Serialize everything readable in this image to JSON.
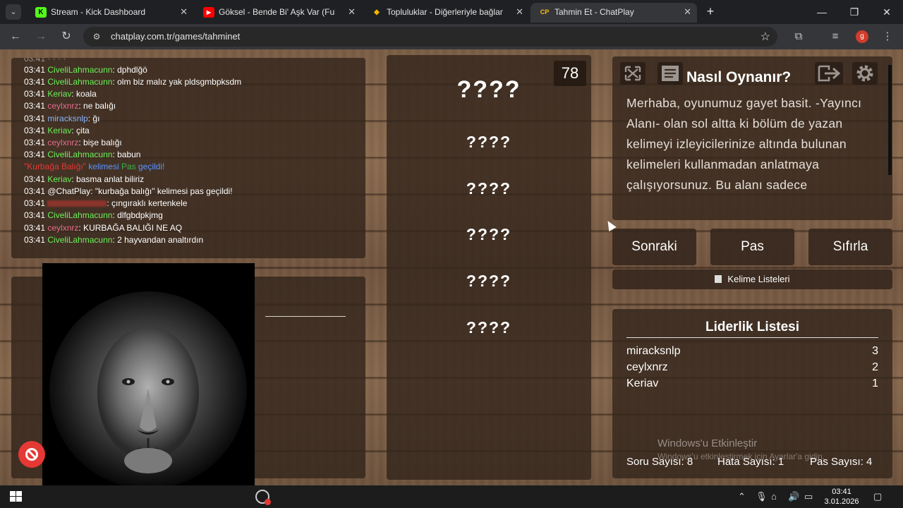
{
  "browser": {
    "tabs": [
      {
        "title": "Stream - Kick Dashboard",
        "favicon": "kick-icon",
        "color": "#53fc18",
        "glyph": "K"
      },
      {
        "title": "Göksel - Bende Bi' Aşk Var (Full",
        "favicon": "youtube-icon",
        "color": "#ff0000",
        "glyph": "▶"
      },
      {
        "title": "Topluluklar - Diğerleriyle bağlan",
        "favicon": "community-icon",
        "color": "#f4b400",
        "glyph": "◆"
      },
      {
        "title": "Tahmin Et - ChatPlay",
        "favicon": "chatplay-icon",
        "color": "#fbbc04",
        "glyph": "CP"
      }
    ],
    "url": "chatplay.com.tr/games/tahminet",
    "profile_initial": "g"
  },
  "chat": {
    "messages": [
      {
        "time": "03:41",
        "user": "CiveliLahmacunn",
        "user_color": "green",
        "text": ": dphdlğö"
      },
      {
        "time": "03:41",
        "user": "CiveliLahmacunn",
        "user_color": "green",
        "text": ": olm biz malız yak pldsgmbpksdm"
      },
      {
        "time": "03:41",
        "user": "Keriav",
        "user_color": "green",
        "text": ": koala"
      },
      {
        "time": "03:41",
        "user": "ceylxnrz",
        "user_color": "pink",
        "text": ": ne balığı"
      },
      {
        "time": "03:41",
        "user": "miracksnlp",
        "user_color": "blue",
        "text": ": ğı"
      },
      {
        "time": "03:41",
        "user": "Keriav",
        "user_color": "green",
        "text": ": çita"
      },
      {
        "time": "03:41",
        "user": "ceylxnrz",
        "user_color": "pink",
        "text": ": bişe balığı"
      },
      {
        "time": "03:41",
        "user": "CiveliLahmacunn",
        "user_color": "green",
        "text": ": babun"
      },
      {
        "time": "03:41",
        "user": "Keriav",
        "user_color": "green",
        "text": ": basma anlat biliriz"
      },
      {
        "time": "03:41",
        "user": "@ChatPlay",
        "user_color": "white",
        "text": ": \"kurbağa balığı\" kelimesi pas geçildi!"
      },
      {
        "time": "03:41",
        "user": "",
        "user_color": "red",
        "text": ": çıngıraklı kertenkele"
      },
      {
        "time": "03:41",
        "user": "CiveliLahmacunn",
        "user_color": "green",
        "text": ": dlfgbdpkjmg"
      },
      {
        "time": "03:41",
        "user": "ceylxnrz",
        "user_color": "pink",
        "text": ": KURBAĞA BALIĞI NE AQ"
      },
      {
        "time": "03:41",
        "user": "CiveliLahmacunn",
        "user_color": "green",
        "text": ": 2 hayvandan analtırdın"
      }
    ],
    "system_notice": {
      "word": "\"Kurbağa Balığı\"",
      "kelimesi": "kelimesi",
      "pas": "Pas",
      "gecildi": "geçildi!"
    }
  },
  "game": {
    "counter": "78",
    "main_word": "????",
    "forbidden_words": [
      "????",
      "????",
      "????",
      "????",
      "????"
    ]
  },
  "howto": {
    "title": "Nasıl Oynanır?",
    "text": "Merhaba, oyunumuz gayet basit. -Yayıncı Alanı- olan sol altta ki bölüm de yazan kelimeyi izleyicilerinize altında bulunan kelimeleri kullanmadan anlatmaya çalışıyorsunuz. Bu alanı sadece"
  },
  "controls": {
    "next": "Sonraki",
    "pass": "Pas",
    "reset": "Sıfırla",
    "word_lists": "Kelime Listeleri"
  },
  "leaderboard": {
    "title": "Liderlik Listesi",
    "rows": [
      {
        "name": "miracksnlp",
        "score": "3"
      },
      {
        "name": "ceylxnrz",
        "score": "2"
      },
      {
        "name": "Keriav",
        "score": "1"
      }
    ],
    "stats": {
      "questions": "Soru Sayısı: 8",
      "errors": "Hata Sayısı: 1",
      "passes": "Pas Sayısı: 4"
    }
  },
  "watermark": {
    "line1": "Windows'u Etkinleştir",
    "line2": "Windows'u etkinleştirmek için Ayarlar'a gidin."
  },
  "taskbar": {
    "time": "03:41",
    "date": "3.01.2026"
  }
}
